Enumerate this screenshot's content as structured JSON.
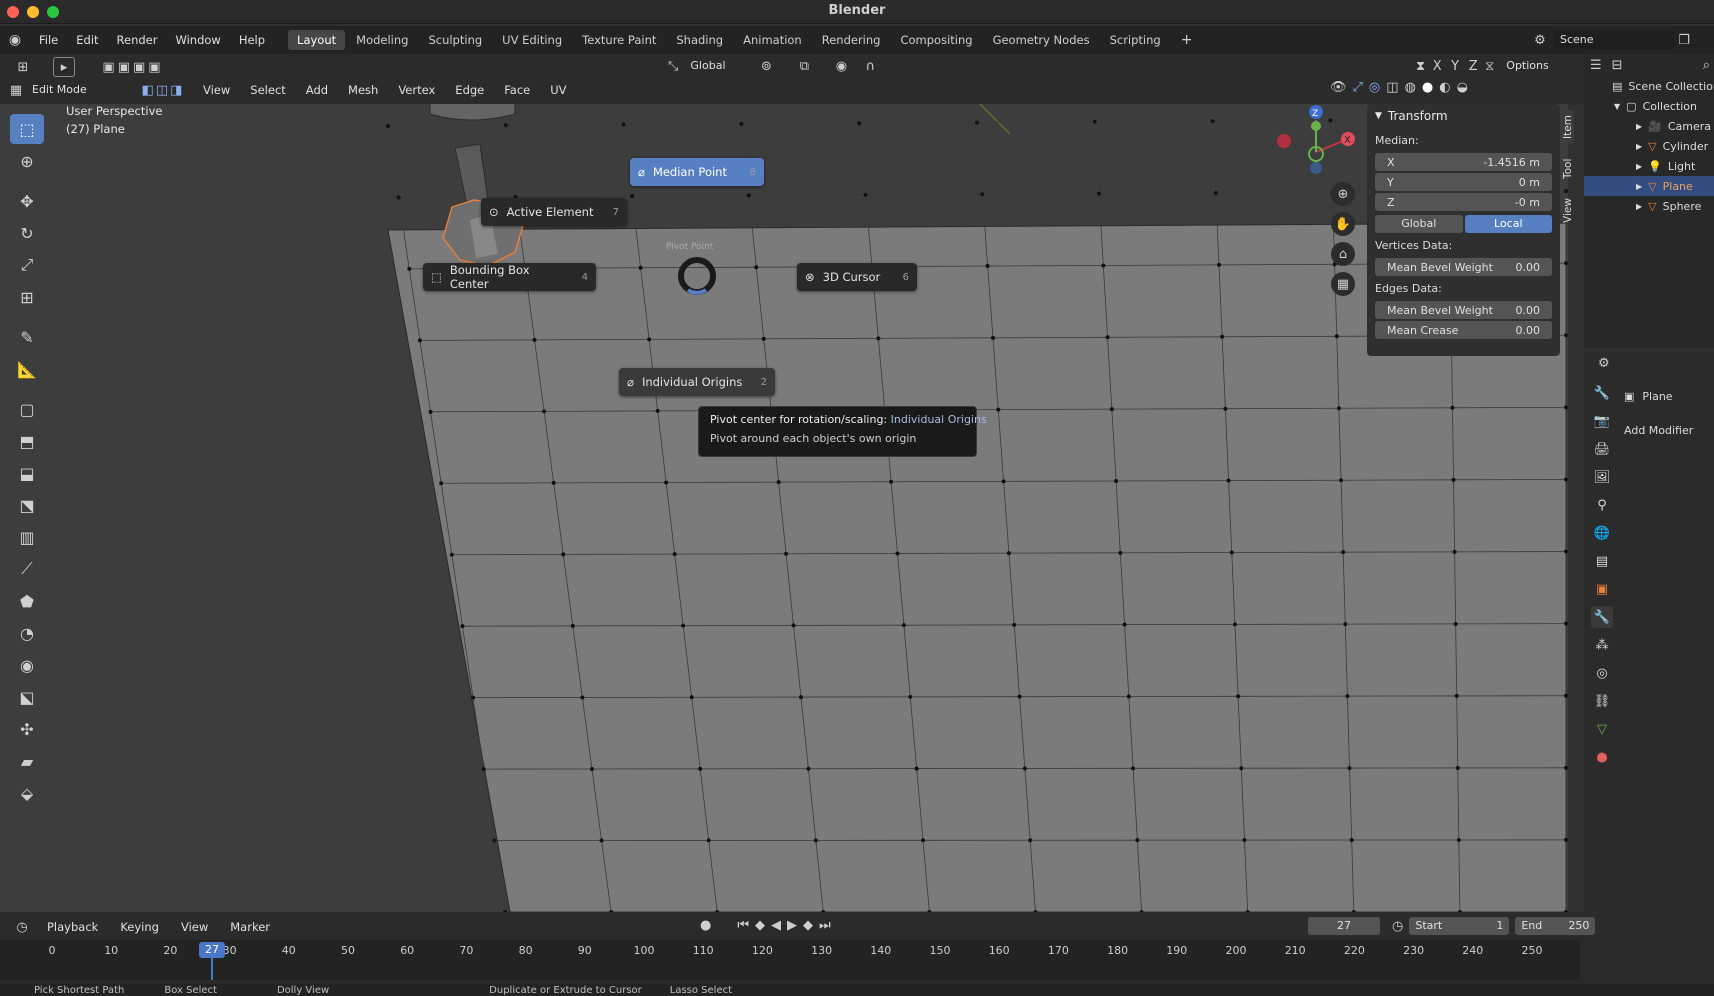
{
  "window": {
    "title": "Blender"
  },
  "menus": [
    "File",
    "Edit",
    "Render",
    "Window",
    "Help"
  ],
  "workspaces": [
    "Layout",
    "Modeling",
    "Sculpting",
    "UV Editing",
    "Texture Paint",
    "Shading",
    "Animation",
    "Rendering",
    "Compositing",
    "Geometry Nodes",
    "Scripting"
  ],
  "active_workspace": "Layout",
  "scene": "Scene",
  "header": {
    "mode": "Edit Mode",
    "menus": [
      "View",
      "Select",
      "Add",
      "Mesh",
      "Vertex",
      "Edge",
      "Face",
      "UV"
    ],
    "orientation": "Global",
    "axes": [
      "X",
      "Y",
      "Z"
    ],
    "options": "Options"
  },
  "viewport": {
    "perspective": "User Perspective",
    "object_label": "(27) Plane",
    "pivot_title": "Pivot Point"
  },
  "pie_menu": [
    {
      "label": "Median Point",
      "key": "8"
    },
    {
      "label": "Active Element",
      "key": "7"
    },
    {
      "label": "Bounding Box Center",
      "key": "4"
    },
    {
      "label": "3D Cursor",
      "key": "6"
    },
    {
      "label": "Individual Origins",
      "key": "2"
    }
  ],
  "tooltip": {
    "prefix": "Pivot center for rotation/scaling:",
    "value": "Individual Origins",
    "description": "Pivot around each object's own origin"
  },
  "transform_panel": {
    "title": "Transform",
    "median_label": "Median:",
    "x": {
      "label": "X",
      "value": "-1.4516 m"
    },
    "y": {
      "label": "Y",
      "value": "0 m"
    },
    "z": {
      "label": "Z",
      "value": "-0 m"
    },
    "global": "Global",
    "local": "Local",
    "vertices_label": "Vertices Data:",
    "vertex_bevel": {
      "label": "Mean Bevel Weight",
      "value": "0.00"
    },
    "edges_label": "Edges Data:",
    "edge_bevel": {
      "label": "Mean Bevel Weight",
      "value": "0.00"
    },
    "edge_crease": {
      "label": "Mean Crease",
      "value": "0.00"
    }
  },
  "side_tabs": [
    "Item",
    "Tool",
    "View"
  ],
  "outliner": {
    "root": "Scene Collection",
    "collection": "Collection",
    "items": [
      "Camera",
      "Cylinder",
      "Light",
      "Plane",
      "Sphere"
    ]
  },
  "properties": {
    "object_name": "Plane",
    "add_modifier": "Add Modifier"
  },
  "timeline": {
    "menus": [
      "Playback",
      "Keying",
      "View",
      "Marker"
    ],
    "current_frame": "27",
    "start_label": "Start",
    "start": "1",
    "end_label": "End",
    "end": "250",
    "ticks": [
      "0",
      "10",
      "20",
      "30",
      "40",
      "50",
      "60",
      "70",
      "80",
      "90",
      "100",
      "110",
      "120",
      "130",
      "140",
      "150",
      "160",
      "170",
      "180",
      "190",
      "200",
      "210",
      "220",
      "230",
      "240",
      "250"
    ]
  },
  "statusbar": [
    "Pick Shortest Path",
    "Box Select",
    "Dolly View",
    "Duplicate or Extrude to Cursor",
    "Lasso Select"
  ],
  "colors": {
    "accent": "#5680c2",
    "selected_orange": "#e8803a"
  }
}
